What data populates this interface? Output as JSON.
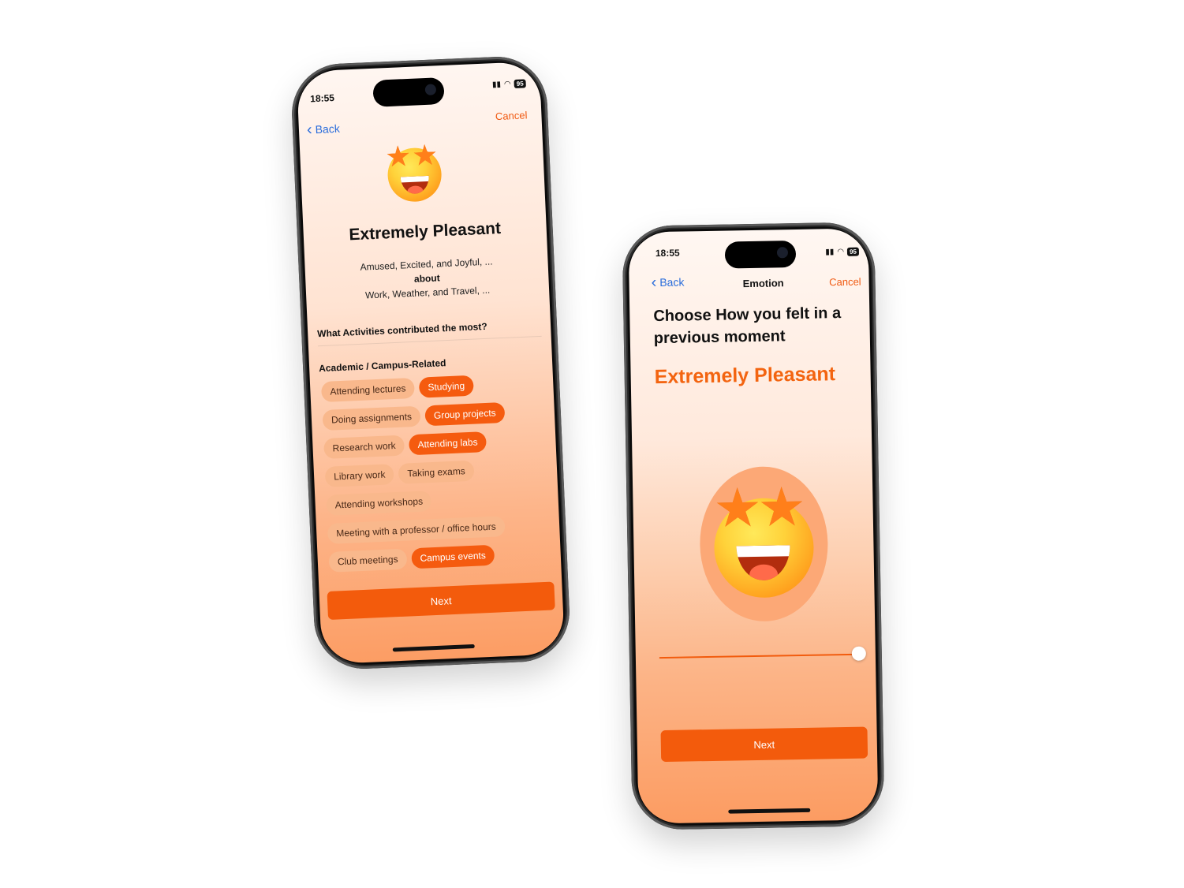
{
  "phone1": {
    "status_time": "18:55",
    "battery": "95",
    "back_label": "Back",
    "cancel_label": "Cancel",
    "heading": "Extremely Pleasant",
    "emotions_line": "Amused, Excited, and Joyful, ...",
    "about_label": "about",
    "topics_line": "Work, Weather, and Travel, ...",
    "question": "What Activities contributed the most?",
    "category": "Academic / Campus-Related",
    "chip_rows": [
      [
        {
          "label": "Attending lectures",
          "selected": false
        },
        {
          "label": "Studying",
          "selected": true
        }
      ],
      [
        {
          "label": "Doing assignments",
          "selected": false
        },
        {
          "label": "Group projects",
          "selected": true
        }
      ],
      [
        {
          "label": "Research work",
          "selected": false
        },
        {
          "label": "Attending labs",
          "selected": true
        }
      ],
      [
        {
          "label": "Library work",
          "selected": false
        },
        {
          "label": "Taking exams",
          "selected": false
        }
      ],
      [
        {
          "label": "Attending workshops",
          "selected": false
        }
      ],
      [
        {
          "label": "Meeting with a professor / office hours",
          "selected": false
        }
      ],
      [
        {
          "label": "Club meetings",
          "selected": false
        },
        {
          "label": "Campus events",
          "selected": true
        }
      ]
    ],
    "next_label": "Next",
    "emoji_icon": "star-struck-emoji-icon"
  },
  "phone2": {
    "status_time": "18:55",
    "battery": "95",
    "back_label": "Back",
    "nav_title": "Emotion",
    "cancel_label": "Cancel",
    "prompt_line1": "Choose How you felt in a",
    "prompt_line2": "previous moment",
    "emotion_label": "Extremely Pleasant",
    "slider_value": 1.0,
    "next_label": "Next",
    "emoji_icon": "star-struck-emoji-icon"
  },
  "colors": {
    "accent": "#f35b0c",
    "link": "#2a6ddb",
    "chip": "#f9b88c"
  }
}
